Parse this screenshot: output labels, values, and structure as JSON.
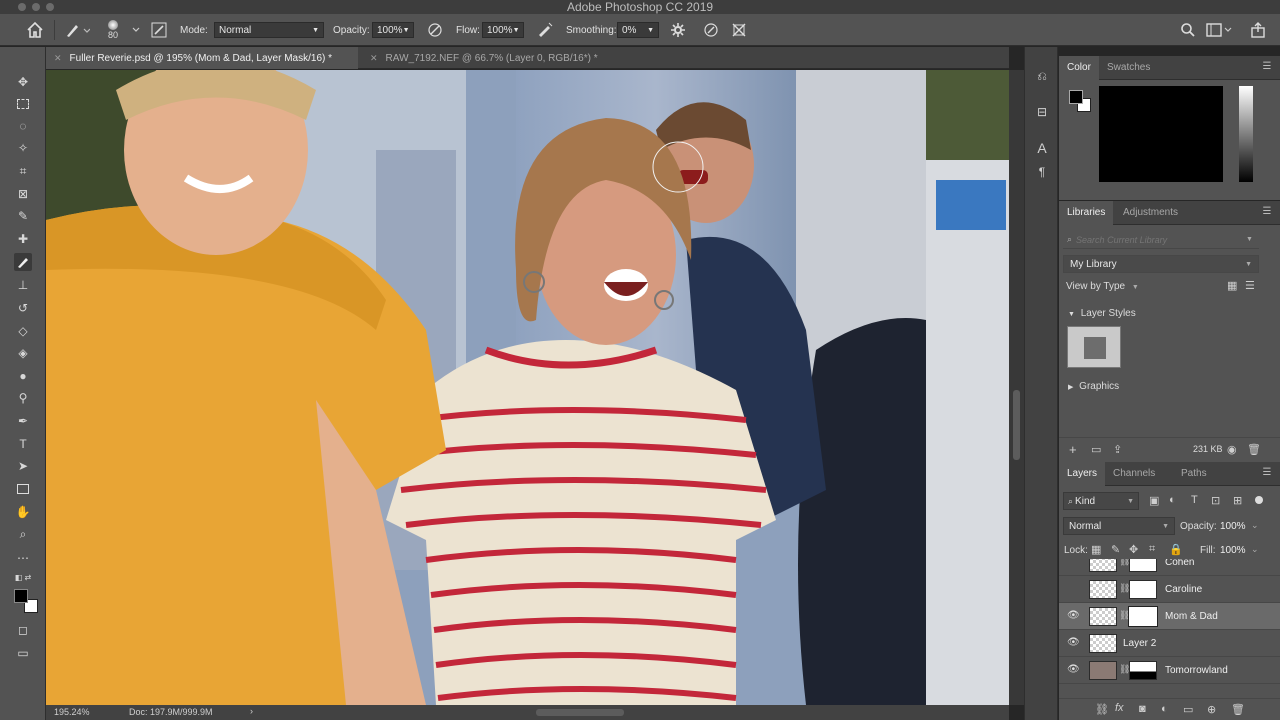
{
  "app_title": "Adobe Photoshop CC 2019",
  "options": {
    "brush_size": "80",
    "mode_label": "Mode:",
    "mode_value": "Normal",
    "opacity_label": "Opacity:",
    "opacity_value": "100%",
    "flow_label": "Flow:",
    "flow_value": "100%",
    "smoothing_label": "Smoothing:",
    "smoothing_value": "0%"
  },
  "tabs": [
    {
      "label": "Fuller Reverie.psd @ 195% (Mom & Dad, Layer Mask/16) *"
    },
    {
      "label": "RAW_7192.NEF @ 66.7% (Layer 0, RGB/16*) *"
    }
  ],
  "status": {
    "zoom": "195.24%",
    "doc": "Doc: 197.9M/999.9M"
  },
  "color_panel": {
    "tabs": [
      "Color",
      "Swatches"
    ],
    "fg": "#000000",
    "bg": "#ffffff"
  },
  "libraries_panel": {
    "tabs": [
      "Libraries",
      "Adjustments"
    ],
    "search_placeholder": "Search Current Library",
    "library_name": "My Library",
    "view_by": "View by Type",
    "layer_styles": "Layer Styles",
    "graphics": "Graphics",
    "size": "231 KB"
  },
  "layers_panel": {
    "tabs": [
      "Layers",
      "Channels",
      "Paths"
    ],
    "filter_kind": "Kind",
    "blend_mode": "Normal",
    "opacity_label": "Opacity:",
    "opacity_value": "100%",
    "lock_label": "Lock:",
    "fill_label": "Fill:",
    "fill_value": "100%",
    "layers": [
      {
        "name": "Cohen",
        "visible": false,
        "selected": false
      },
      {
        "name": "Caroline",
        "visible": false,
        "selected": false
      },
      {
        "name": "Mom & Dad",
        "visible": true,
        "selected": true
      },
      {
        "name": "Layer 2",
        "visible": true,
        "selected": false
      },
      {
        "name": "Tomorrowland",
        "visible": true,
        "selected": false
      }
    ]
  }
}
